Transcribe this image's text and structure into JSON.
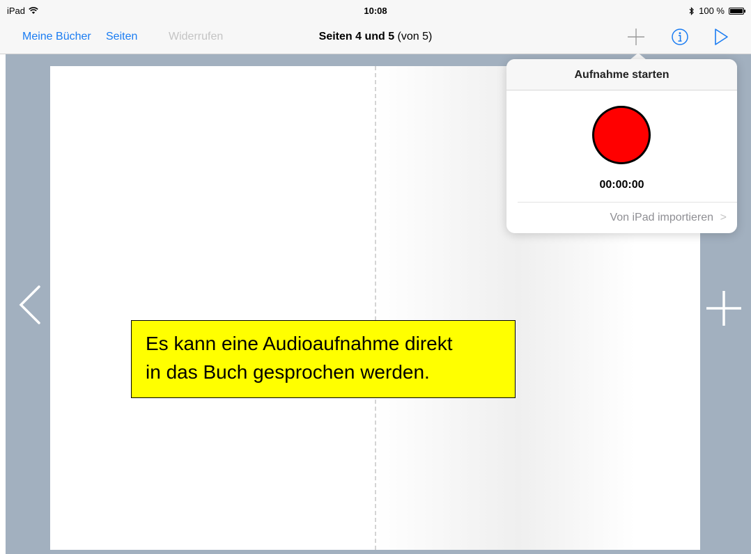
{
  "status_bar": {
    "device": "iPad",
    "time": "10:08",
    "battery": "100 %",
    "icons": [
      "wifi-icon",
      "bluetooth-icon",
      "battery-icon"
    ]
  },
  "nav": {
    "my_books": "Meine Bücher",
    "pages": "Seiten",
    "undo": "Widerrufen",
    "title_bold": "Seiten 4 und 5",
    "title_rest": " (von 5)",
    "icons": [
      "plus-icon",
      "info-icon",
      "play-icon"
    ]
  },
  "page_nav": {
    "icons": [
      "chevron-left-icon",
      "add-page-icon"
    ]
  },
  "caption": {
    "line1": "Es kann eine Audioaufnahme direkt",
    "line2": "in das Buch gesprochen werden."
  },
  "popover": {
    "title": "Aufnahme starten",
    "timer": "00:00:00",
    "import_label": "Von iPad importieren",
    "import_chevron": ">"
  },
  "colors": {
    "accent": "#1a7cf2",
    "disabled": "#c4c4c4",
    "record": "#ff0000",
    "stage": "#a2b0bf",
    "caption_bg": "#ffff00"
  }
}
